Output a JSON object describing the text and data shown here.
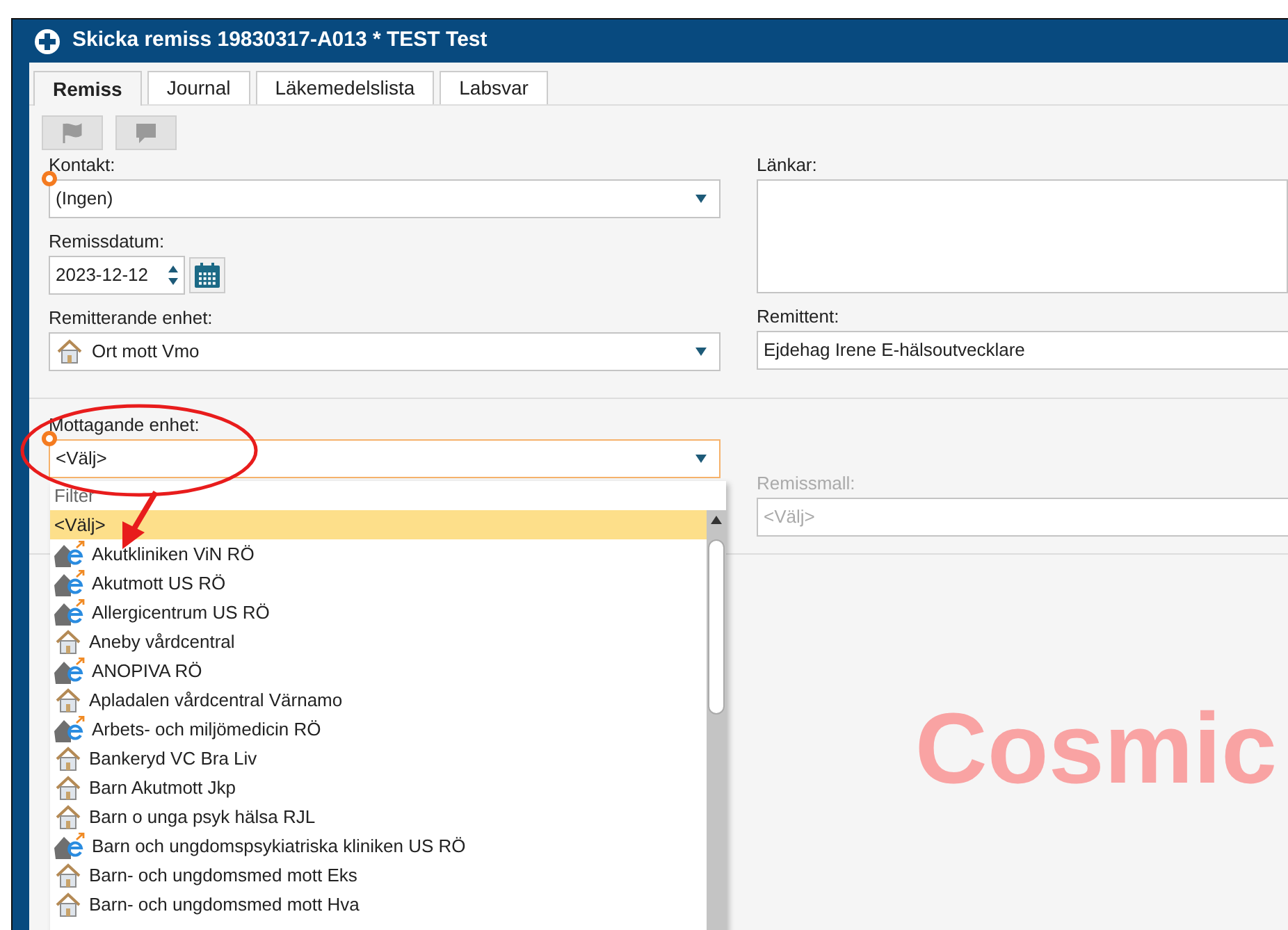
{
  "window": {
    "title": "Skicka remiss 19830317-A013 * TEST Test"
  },
  "tabs": [
    {
      "label": "Remiss",
      "selected": true
    },
    {
      "label": "Journal",
      "selected": false
    },
    {
      "label": "Läkemedelslista",
      "selected": false
    },
    {
      "label": "Labsvar",
      "selected": false
    }
  ],
  "toolbar": [
    {
      "kind": "flag",
      "disabled": true
    },
    {
      "kind": "comment",
      "disabled": true
    }
  ],
  "contact": {
    "label": "Kontakt:",
    "value": "(Ingen)",
    "required": true
  },
  "referral_date": {
    "label": "Remissdatum:",
    "value": "2023-12-12"
  },
  "referring_unit": {
    "label": "Remitterande enhet:",
    "value": "Ort mott Vmo",
    "kind": "house"
  },
  "links": {
    "label": "Länkar:"
  },
  "referrer": {
    "label": "Remittent:",
    "value": "Ejdehag Irene E-hälsoutvecklare"
  },
  "receiving_unit": {
    "label": "Mottagande enhet:",
    "value": "<Välj>",
    "required": true,
    "open": true,
    "filter_placeholder": "Filter",
    "options": [
      {
        "label": "<Välj>",
        "kind": "none",
        "selected": true
      },
      {
        "label": "Akutkliniken ViN RÖ",
        "kind": "eservice",
        "selected": false
      },
      {
        "label": "Akutmott US RÖ",
        "kind": "eservice",
        "selected": false
      },
      {
        "label": "Allergicentrum US RÖ",
        "kind": "eservice",
        "selected": false
      },
      {
        "label": "Aneby vårdcentral",
        "kind": "house",
        "selected": false
      },
      {
        "label": "ANOPIVA RÖ",
        "kind": "eservice",
        "selected": false
      },
      {
        "label": "Apladalen vårdcentral Värnamo",
        "kind": "house",
        "selected": false
      },
      {
        "label": "Arbets- och miljömedicin RÖ",
        "kind": "eservice",
        "selected": false
      },
      {
        "label": "Bankeryd VC Bra Liv",
        "kind": "house",
        "selected": false
      },
      {
        "label": "Barn Akutmott Jkp",
        "kind": "house",
        "selected": false
      },
      {
        "label": "Barn o unga psyk hälsa RJL",
        "kind": "house",
        "selected": false
      },
      {
        "label": "Barn och ungdomspsykiatriska kliniken US RÖ",
        "kind": "eservice",
        "selected": false
      },
      {
        "label": "Barn- och ungdomsmed mott Eks",
        "kind": "house",
        "selected": false
      },
      {
        "label": "Barn- och ungdomsmed mott Hva",
        "kind": "house",
        "selected": false
      }
    ]
  },
  "template": {
    "label": "Remissmall:",
    "value": "<Välj>",
    "disabled": true
  },
  "brand_text": "Cosmic",
  "annotations": {
    "ellipse": true,
    "arrow": true
  }
}
